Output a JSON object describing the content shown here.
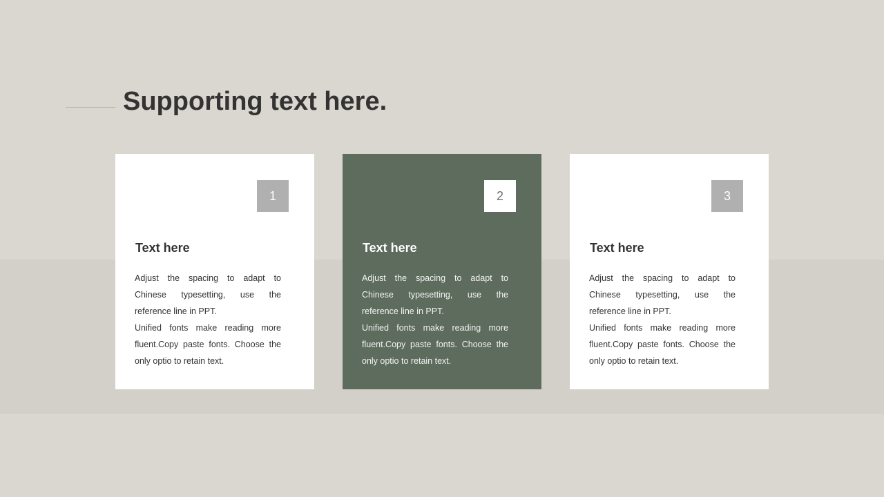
{
  "slide": {
    "title": "Supporting text here.",
    "colors": {
      "background": "#dad7d0",
      "band": "#d3d0c9",
      "card_light": "#ffffff",
      "card_accent": "#5e6c5e",
      "number_box": "#b0b0b0",
      "text": "#333333"
    },
    "cards": [
      {
        "number": "1",
        "heading": "Text here",
        "body": "Adjust the spacing to adapt to Chinese typesetting, use the reference line in PPT.\nUnified  fonts make reading more fluent.Copy paste fonts. Choose the only optio to retain text."
      },
      {
        "number": "2",
        "heading": "Text here",
        "body": "Adjust the spacing to adapt to Chinese typesetting, use the reference line in PPT.\nUnified  fonts make reading more fluent.Copy paste fonts. Choose the only optio to retain text."
      },
      {
        "number": "3",
        "heading": "Text here",
        "body": "Adjust the spacing to adapt to Chinese typesetting, use the reference line in PPT.\nUnified  fonts make reading more fluent.Copy paste fonts. Choose the only optio to retain text."
      }
    ]
  }
}
